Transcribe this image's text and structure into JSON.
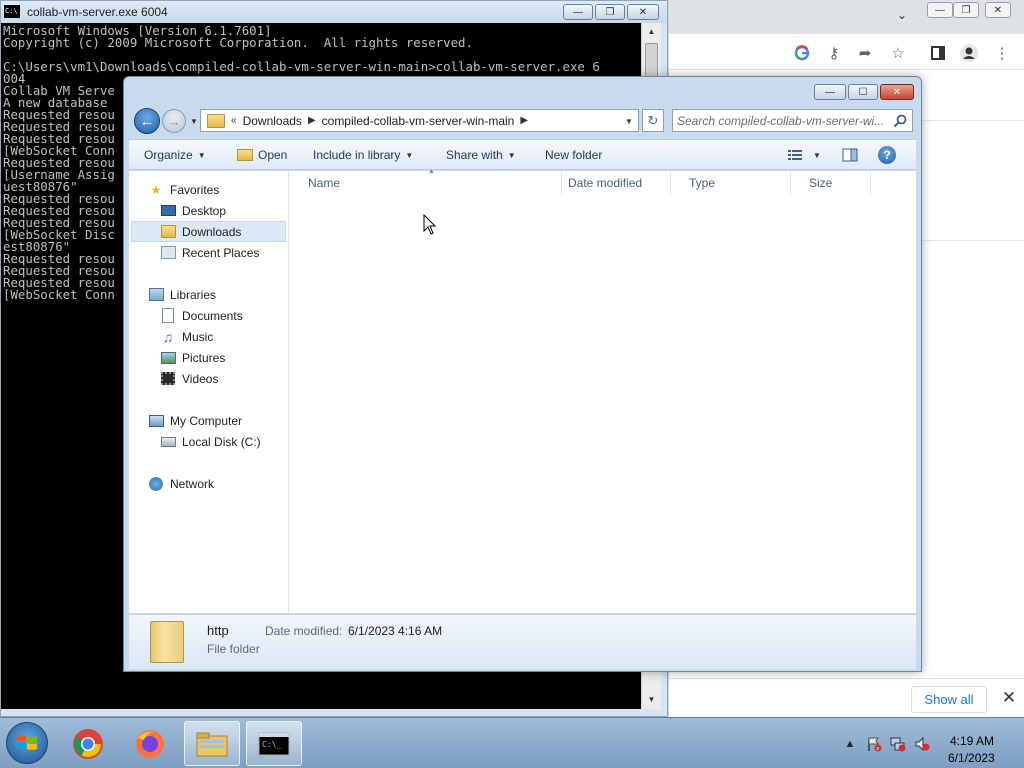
{
  "console": {
    "title": "collab-vm-server.exe 6004",
    "lines": [
      "Microsoft Windows [Version 6.1.7601]",
      "Copyright (c) 2009 Microsoft Corporation.  All rights reserved.",
      "",
      "C:\\Users\\vm1\\Downloads\\compiled-collab-vm-server-win-main>collab-vm-server.exe 6",
      "004",
      "Collab VM Serve",
      "A new database",
      "Requested resou",
      "Requested resou",
      "Requested resou",
      "[WebSocket Conn",
      "Requested resou",
      "[Username Assig",
      "uest80876\"",
      "Requested resou",
      "Requested resou",
      "Requested resou",
      "[WebSocket Disc",
      "est80876\"",
      "Requested resou",
      "Requested resou",
      "Requested resou",
      "[WebSocket Conn"
    ]
  },
  "chrome": {
    "show_all_label": "Show all"
  },
  "explorer": {
    "breadcrumbs": [
      "Downloads",
      "compiled-collab-vm-server-win-main"
    ],
    "search_placeholder": "Search compiled-collab-vm-server-wi...",
    "toolbar": {
      "organize": "Organize",
      "open": "Open",
      "include_in_library": "Include in library",
      "share_with": "Share with",
      "new_folder": "New folder"
    },
    "nav": {
      "favorites": "Favorites",
      "desktop": "Desktop",
      "downloads": "Downloads",
      "recent_places": "Recent Places",
      "libraries": "Libraries",
      "documents": "Documents",
      "music": "Music",
      "pictures": "Pictures",
      "videos": "Videos",
      "my_computer": "My Computer",
      "local_disk": "Local Disk (C:)",
      "network": "Network"
    },
    "columns": {
      "name": "Name",
      "date_modified": "Date modified",
      "type": "Type",
      "size": "Size"
    },
    "details": {
      "name": "http",
      "type": "File folder",
      "modified_label": "Date modified:",
      "modified_value": "6/1/2023 4:16 AM"
    }
  },
  "taskbar": {
    "time": "4:19 AM",
    "date": "6/1/2023"
  },
  "colors": {
    "console_bg": "#000000",
    "console_text": "#c0c0c0",
    "chrome_link": "#1a73e8",
    "explorer_frame": "#c8dbee"
  }
}
